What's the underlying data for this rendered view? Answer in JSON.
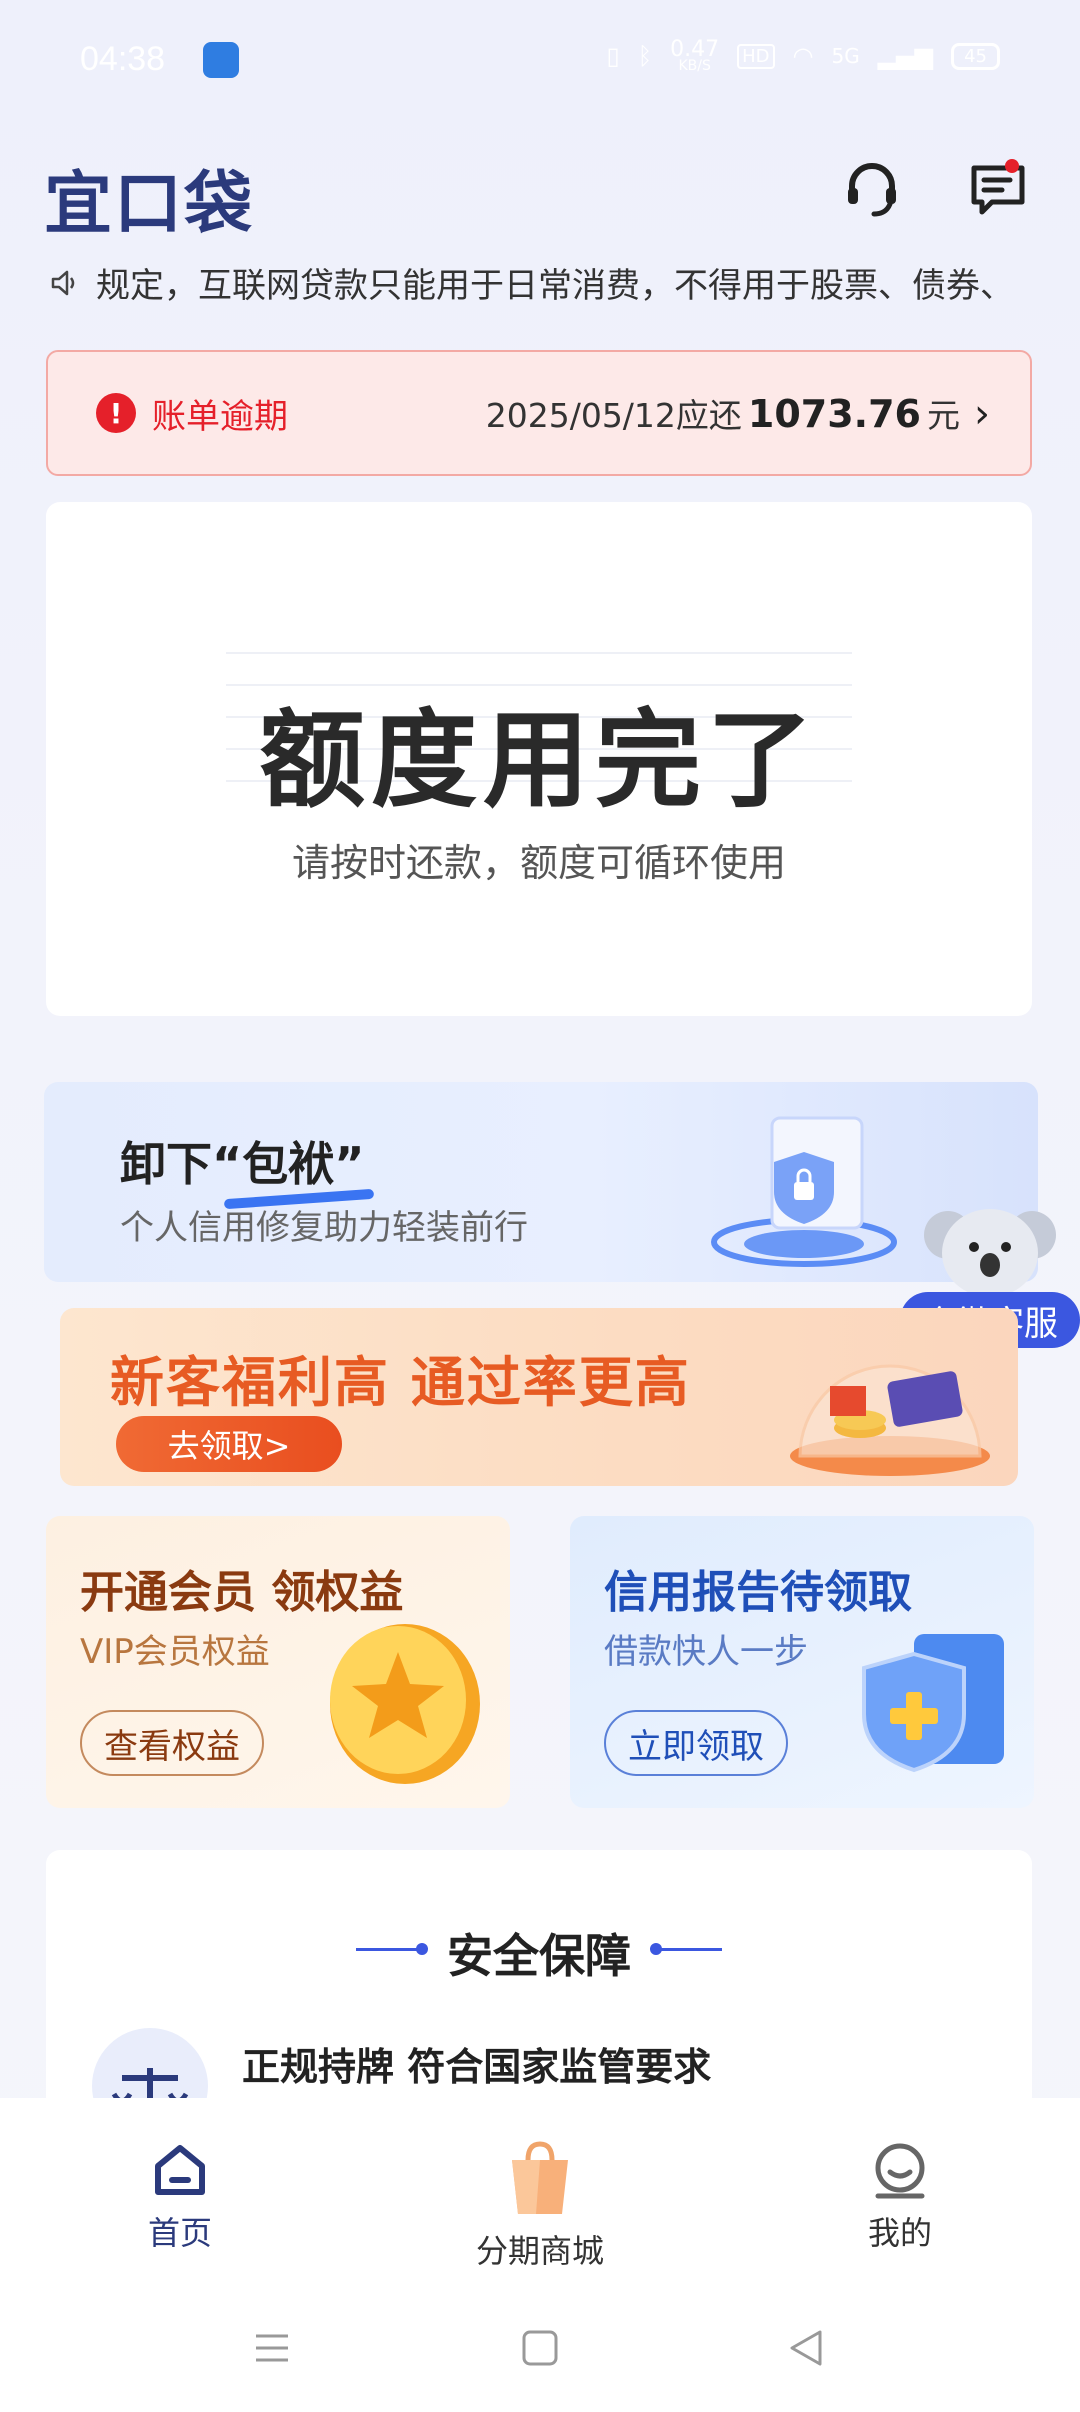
{
  "status_bar": {
    "time": "04:38",
    "speed": "0.47",
    "speed_unit": "KB/S",
    "hd": "HD",
    "network": "5G",
    "battery": "45"
  },
  "header": {
    "logo": "宜口袋",
    "service_icon": "headset-icon",
    "message_icon": "message-icon"
  },
  "notice": {
    "icon": "speaker-icon",
    "text": "规定，互联网贷款只能用于日常消费，不得用于股票、债券、"
  },
  "overdue": {
    "label": "账单逾期",
    "date_text": "2025/05/12应还",
    "amount": "1073.76",
    "unit": "元"
  },
  "quota": {
    "title": "额度用完了",
    "subtitle": "请按时还款，额度可循环使用"
  },
  "banner_credit_repair": {
    "title": "卸下“包袱”",
    "subtitle": "个人信用修复助力轻装前行"
  },
  "kefu": {
    "label": "企微客服"
  },
  "banner_new_customer": {
    "title": "新客福利高 通过率更高",
    "button": "去领取>"
  },
  "cards": [
    {
      "title": "开通会员 领权益",
      "subtitle": "VIP会员权益",
      "button": "查看权益"
    },
    {
      "title": "信用报告待领取",
      "subtitle": "借款快人一步",
      "button": "立即领取"
    }
  ],
  "safety": {
    "title": "安全保障",
    "item": "正规持牌 符合国家监管要求"
  },
  "bottom_nav": [
    {
      "label": "首页",
      "icon": "home-icon"
    },
    {
      "label": "分期商城",
      "icon": "shopping-bag-icon"
    },
    {
      "label": "我的",
      "icon": "profile-icon"
    }
  ],
  "colors": {
    "brand": "#2b3a7c",
    "accent": "#3b57e0",
    "alert": "#e5202a",
    "orange": "#e75b23"
  }
}
